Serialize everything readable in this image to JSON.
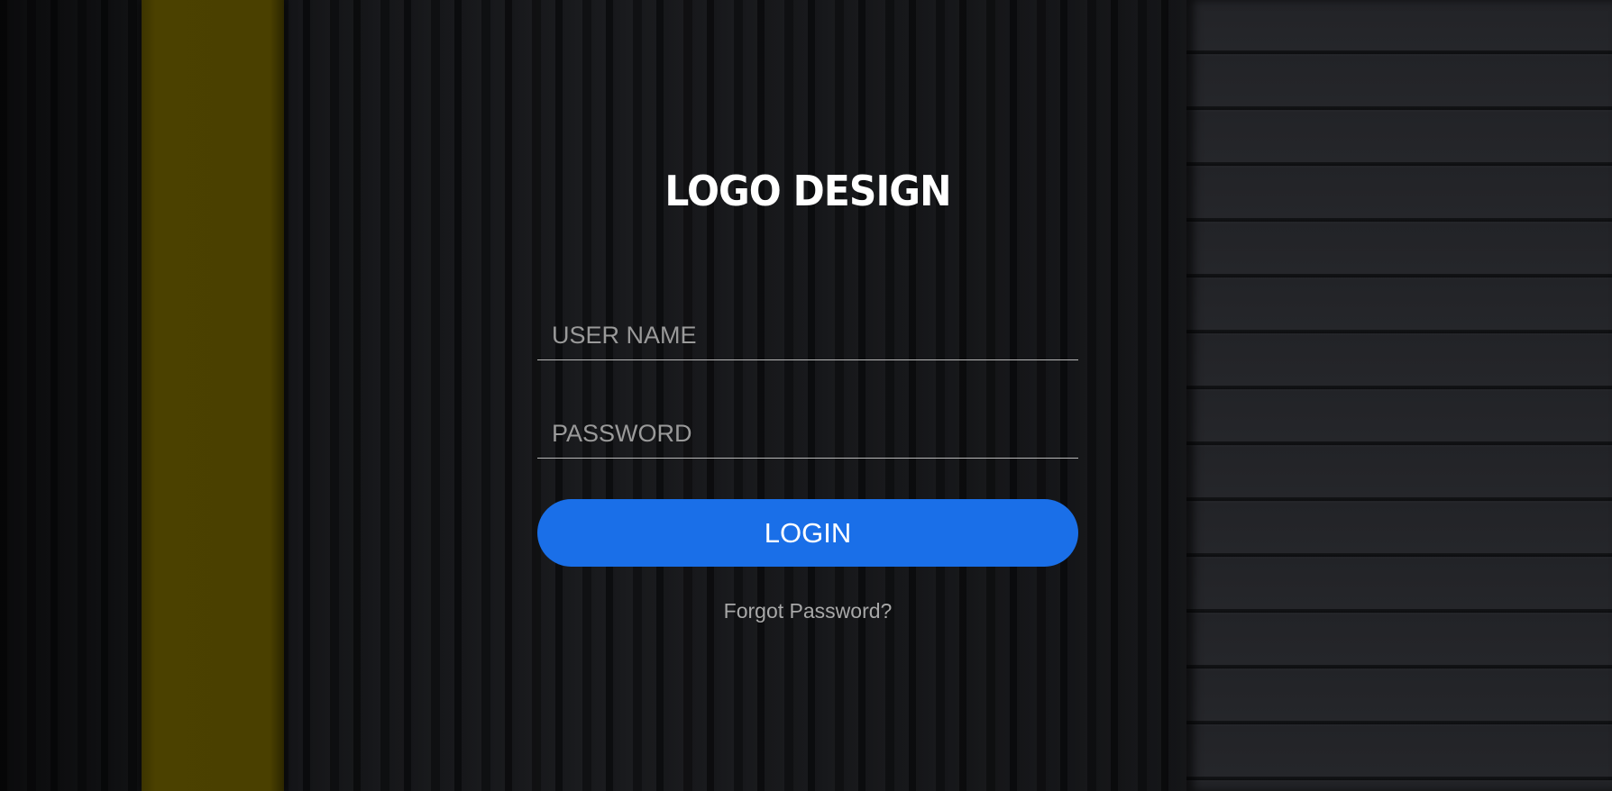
{
  "login": {
    "title": "LOGO DESIGN",
    "username_placeholder": "USER NAME",
    "password_placeholder": "PASSWORD",
    "login_label": "LOGIN",
    "forgot_label": "Forgot Password?"
  },
  "colors": {
    "accent": "#1a6fe8",
    "title_text": "#ffffff",
    "placeholder_text": "#9a9a9a",
    "background": "#111214",
    "yellow_stripe": "#4a4000"
  }
}
